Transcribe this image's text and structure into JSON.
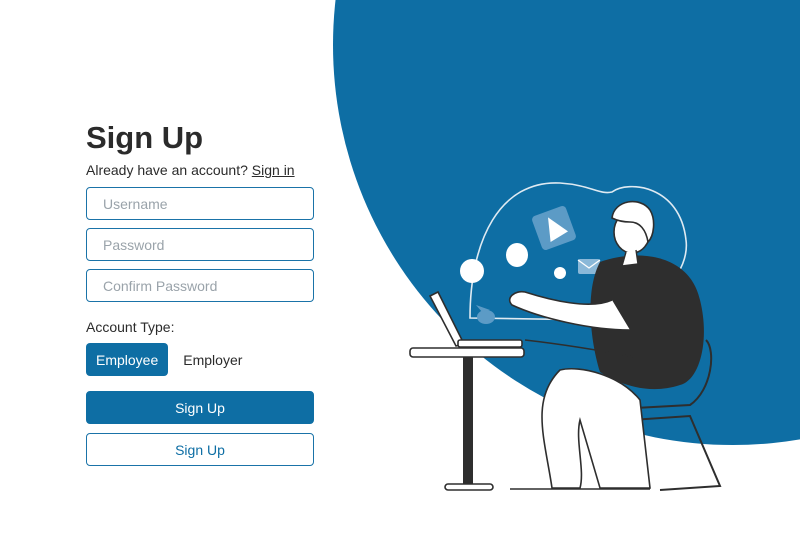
{
  "signup": {
    "title": "Sign Up",
    "have_account_text": "Already have an account?",
    "sign_in_link": "Sign in",
    "username_placeholder": "Username",
    "password_placeholder": "Password",
    "confirm_password_placeholder": "Confirm Password",
    "account_type_label": "Account Type:",
    "account_types": [
      "Employee",
      "Employer"
    ],
    "selected_account_type": "Employee",
    "primary_button": "Sign Up",
    "secondary_button": "Sign Up"
  },
  "colors": {
    "accent": "#0e6ea4",
    "text": "#2b2b2b",
    "placeholder": "#9aa3aa",
    "illustration_dark": "#2e2e2e"
  },
  "icons": [
    "paper-plane-icon",
    "envelope-icon",
    "bird-icon",
    "laptop-icon"
  ]
}
